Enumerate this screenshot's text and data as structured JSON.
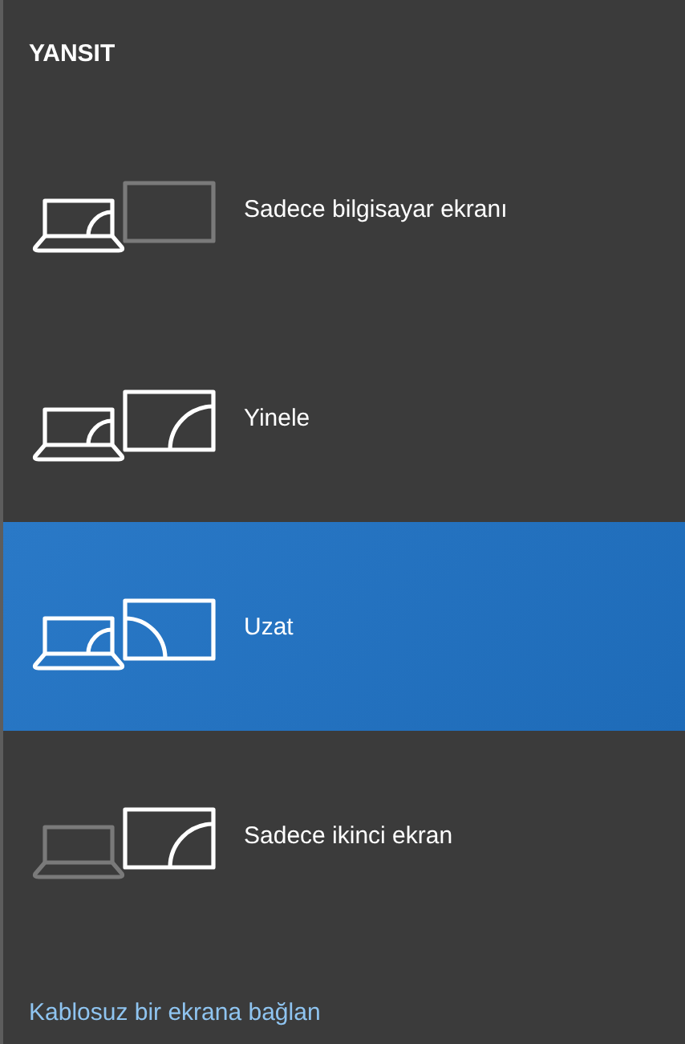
{
  "title": "YANSIT",
  "options": [
    {
      "kind": "pc_only",
      "label": "Sadece bilgisayar ekranı",
      "selected": false
    },
    {
      "kind": "duplicate",
      "label": "Yinele",
      "selected": false
    },
    {
      "kind": "extend",
      "label": "Uzat",
      "selected": true
    },
    {
      "kind": "second_only",
      "label": "Sadece ikinci ekran",
      "selected": false
    }
  ],
  "link": "Kablosuz bir ekrana bağlan"
}
